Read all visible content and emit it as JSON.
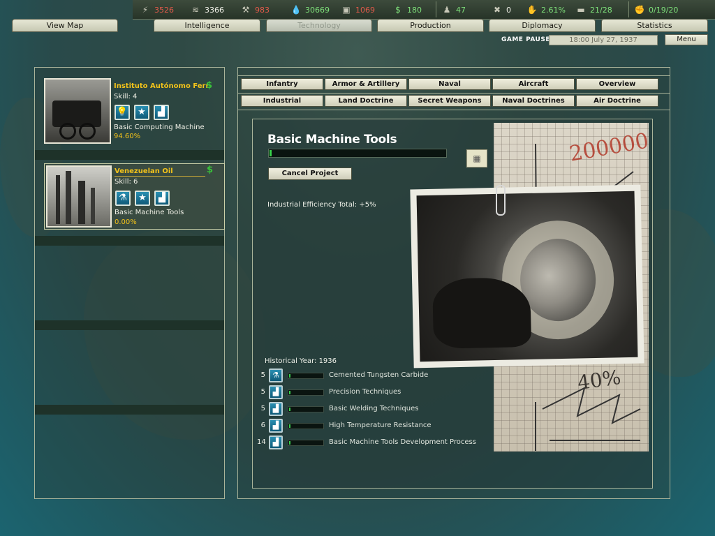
{
  "resources": [
    {
      "icon": "energy-icon",
      "value": "3526",
      "color": "#e15a4a"
    },
    {
      "icon": "metal-icon",
      "value": "3366",
      "color": "#f0f0e8"
    },
    {
      "icon": "rare-materials-icon",
      "value": "983",
      "color": "#e15a4a"
    },
    {
      "icon": "oil-icon",
      "value": "30669",
      "color": "#7ee07a"
    },
    {
      "icon": "supplies-icon",
      "value": "1069",
      "color": "#e15a4a"
    },
    {
      "icon": "money-icon",
      "value": "180",
      "color": "#7ee07a"
    },
    {
      "icon": "manpower-icon",
      "value": "47",
      "color": "#7ee07a"
    },
    {
      "icon": "transports-icon",
      "value": "0",
      "color": "#f0f0e8"
    },
    {
      "icon": "dissent-icon",
      "value": "2.61%",
      "color": "#7ee07a"
    },
    {
      "icon": "convoys-icon",
      "value": "21/28",
      "color": "#7ee07a"
    },
    {
      "icon": "escorts-icon",
      "value": "0/19/20",
      "color": "#7ee07a"
    }
  ],
  "tabs": [
    {
      "label": "View Map"
    },
    {
      "label": "Intelligence"
    },
    {
      "label": "Technology"
    },
    {
      "label": "Production"
    },
    {
      "label": "Diplomacy"
    },
    {
      "label": "Statistics"
    }
  ],
  "status": {
    "paused": "GAME PAUSED",
    "date": "18:00 July 27, 1937",
    "menu": "Menu"
  },
  "teams": [
    {
      "name": "Instituto Autónomo Ferr",
      "skill": "Skill: 4",
      "project": "Basic Computing Machine",
      "progress": "94.60%",
      "icons": [
        "lightbulb-icon",
        "star-icon",
        "factory-icon"
      ]
    },
    {
      "name": "Venezuelan Oil",
      "skill": "Skill: 6",
      "project": "Basic Machine Tools",
      "progress": "0.00%",
      "icons": [
        "flask-icon",
        "star-icon",
        "factory-icon"
      ]
    }
  ],
  "categories_row1": [
    "Infantry",
    "Armor & Artillery",
    "Naval",
    "Aircraft",
    "Overview"
  ],
  "categories_row2": [
    "Industrial",
    "Land Doctrine",
    "Secret Weapons",
    "Naval Doctrines",
    "Air Doctrine"
  ],
  "tech": {
    "title": "Basic Machine Tools",
    "progress_fraction": 0.01,
    "cancel_label": "Cancel Project",
    "effect": "Industrial Efficiency Total: +5%",
    "historical_year": "Historical Year: 1936",
    "requirements": [
      {
        "level": "5",
        "icon": "flask-icon",
        "name": "Cemented Tungsten Carbide"
      },
      {
        "level": "5",
        "icon": "factory-icon",
        "name": "Precision Techniques"
      },
      {
        "level": "5",
        "icon": "factory-icon",
        "name": "Basic Welding Techniques"
      },
      {
        "level": "6",
        "icon": "factory-icon",
        "name": "High Temperature Resistance"
      },
      {
        "level": "14",
        "icon": "factory-icon",
        "name": "Basic Machine Tools Development Process"
      }
    ]
  },
  "paper_annotations": {
    "big_number": "200000",
    "percent": "40%"
  }
}
